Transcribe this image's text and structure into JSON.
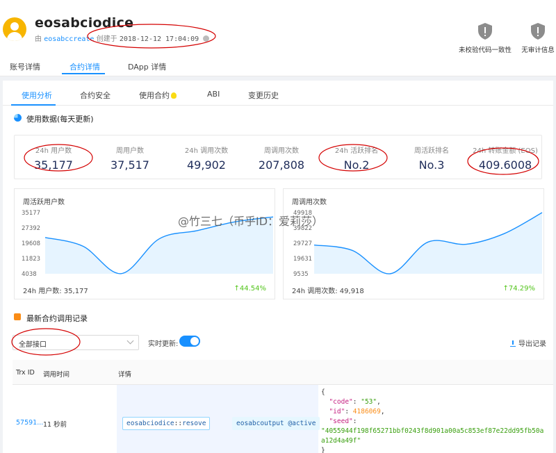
{
  "account": {
    "name": "eosabciodice",
    "creator_prefix": "由",
    "creator": "eosabccreate",
    "created_label": "创建于",
    "created_time": "2018-12-12 17:04:09"
  },
  "badges": [
    {
      "label": "未校验代码一致性"
    },
    {
      "label": "无审计信息"
    }
  ],
  "top_tabs": [
    {
      "label": "账号详情"
    },
    {
      "label": "合约详情"
    },
    {
      "label": "DApp 详情"
    }
  ],
  "sub_tabs": [
    {
      "label": "使用分析"
    },
    {
      "label": "合约安全"
    },
    {
      "label": "使用合约"
    },
    {
      "label": "ABI"
    },
    {
      "label": "变更历史"
    }
  ],
  "usage": {
    "title": "使用数据(每天更新)",
    "stats": [
      {
        "label": "24h 用户数",
        "value": "35,177"
      },
      {
        "label": "周用户数",
        "value": "37,517"
      },
      {
        "label": "24h 调用次数",
        "value": "49,902"
      },
      {
        "label": "周调用次数",
        "value": "207,808"
      },
      {
        "label": "24h 活跃排名",
        "value": "No.2"
      },
      {
        "label": "周活跃排名",
        "value": "No.3"
      },
      {
        "label": "24h 转账金额 (EOS)",
        "value": "409.6008"
      }
    ]
  },
  "charts": {
    "users": {
      "title": "周活跃用户数",
      "ticks": [
        "35177",
        "27392",
        "19608",
        "11823",
        "4038"
      ],
      "footer": "24h 用户数: 35,177",
      "growth": "↑44.54%"
    },
    "calls": {
      "title": "周调用次数",
      "ticks": [
        "49918",
        "39822",
        "29727",
        "19631",
        "9535"
      ],
      "footer": "24h 调用次数: 49,918",
      "growth": "↑74.29%"
    }
  },
  "chart_data": [
    {
      "type": "area",
      "title": "周活跃用户数",
      "x": [
        1,
        2,
        3,
        4,
        5,
        6,
        7
      ],
      "values": [
        22500,
        18000,
        4100,
        21800,
        26000,
        30500,
        33000
      ],
      "ylim": [
        4038,
        35177
      ]
    },
    {
      "type": "area",
      "title": "周调用次数",
      "x": [
        1,
        2,
        3,
        4,
        5,
        6,
        7
      ],
      "values": [
        28500,
        25000,
        9535,
        30500,
        29000,
        36000,
        49918
      ],
      "ylim": [
        9535,
        49918
      ]
    }
  ],
  "watermark": "@竹三七（币乎ID：爱莉莎）",
  "records": {
    "title": "最新合约调用记录",
    "filter_value": "全部接口",
    "realtime_label": "实时更新:",
    "export_label": "导出记录",
    "columns": {
      "trx": "Trx ID",
      "time": "调用时间",
      "detail": "详情"
    },
    "rows": [
      {
        "trx": "57591...",
        "time": "11 秒前",
        "contract": "eosabciodice",
        "separator": "::",
        "action": "resove",
        "actor": "eosabcoutput",
        "permission": "@active",
        "json_open": "{",
        "code_key": "\"code\"",
        "code_val": "\"53\"",
        "id_key": "\"id\"",
        "id_val": "4186069",
        "seed_key": "\"seed\"",
        "seed_val_1": "\"4055944f198f65271bbf0243f8d901a00a5c853ef87e22dd95fb50a",
        "seed_val_2": "a12d4a49f\"",
        "json_close": "}"
      }
    ]
  }
}
